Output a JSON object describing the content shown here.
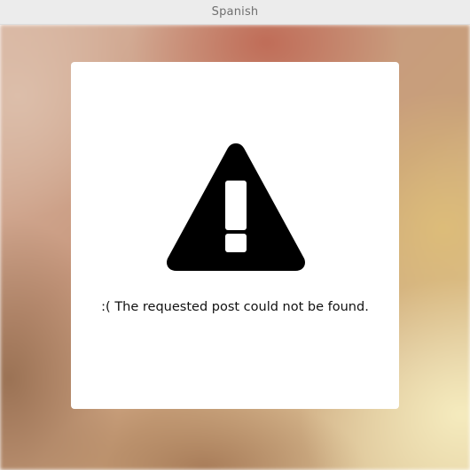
{
  "window": {
    "title": "Spanish"
  },
  "error": {
    "icon": "warning-icon",
    "message": ":( The requested post could not be found."
  }
}
